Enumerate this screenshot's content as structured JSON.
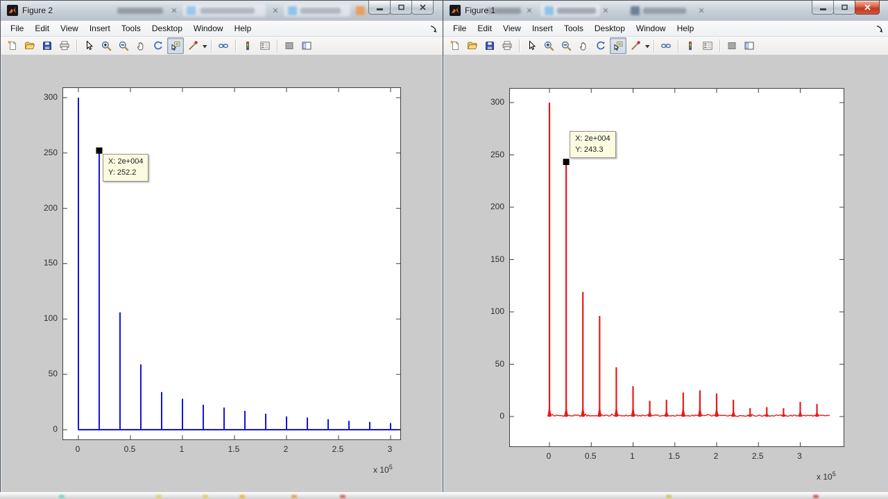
{
  "windows": [
    {
      "title": "Figure 2",
      "menu": [
        "File",
        "Edit",
        "View",
        "Insert",
        "Tools",
        "Desktop",
        "Window",
        "Help"
      ]
    },
    {
      "title": "Figure 1",
      "menu": [
        "File",
        "Edit",
        "View",
        "Insert",
        "Tools",
        "Desktop",
        "Window",
        "Help"
      ]
    }
  ],
  "toolbar": {
    "buttons": [
      {
        "name": "new-figure"
      },
      {
        "name": "open-file"
      },
      {
        "name": "save-figure"
      },
      {
        "name": "print-figure"
      },
      "separator",
      {
        "name": "edit-plot"
      },
      {
        "name": "zoom-in"
      },
      {
        "name": "zoom-out"
      },
      {
        "name": "pan"
      },
      {
        "name": "rotate-3d"
      },
      {
        "name": "data-cursor",
        "pressed": true
      },
      {
        "name": "brush",
        "caret": true
      },
      "separator",
      {
        "name": "link-plot"
      },
      "separator",
      {
        "name": "insert-colorbar"
      },
      {
        "name": "insert-legend"
      },
      "separator",
      {
        "name": "hide-plot-tools"
      },
      {
        "name": "show-plot-tools"
      }
    ]
  },
  "chart_data": [
    {
      "type": "stem",
      "window_title": "Figure 2",
      "series": [
        {
          "name": "spectrum-blue",
          "color": "#1212DF",
          "x": [
            0,
            20000,
            40000,
            60000,
            80000,
            100000,
            120000,
            140000,
            160000,
            180000,
            200000,
            220000,
            240000,
            260000,
            280000,
            300000
          ],
          "values": [
            300,
            252.2,
            106,
            59,
            34,
            28,
            22.5,
            20,
            17,
            14.5,
            12,
            11,
            9.5,
            8,
            7,
            6
          ]
        }
      ],
      "x_tick_labels": [
        "0",
        "0.5",
        "1",
        "1.5",
        "2",
        "2.5",
        "3"
      ],
      "x_tick_values_e5": [
        0,
        0.5,
        1,
        1.5,
        2,
        2.5,
        3
      ],
      "y_tick_labels": [
        "0",
        "50",
        "100",
        "150",
        "200",
        "250",
        "300"
      ],
      "y_tick_values": [
        0,
        50,
        100,
        150,
        200,
        250,
        300
      ],
      "x_scale": {
        "prefix": "x 10",
        "exponent": "5"
      },
      "xlim": [
        -15000,
        310000
      ],
      "ylim": [
        -9,
        309
      ],
      "grid": false,
      "baseline_noise": false,
      "datatip": {
        "x": 20000,
        "y": 252.2,
        "x_text": "X: 2e+004",
        "y_text": "Y: 252.2",
        "placement": "below-right"
      }
    },
    {
      "type": "stem",
      "window_title": "Figure 1",
      "series": [
        {
          "name": "spectrum-red",
          "color": "#E81A1A",
          "x": [
            0,
            20000,
            40000,
            60000,
            80000,
            100000,
            120000,
            140000,
            160000,
            180000,
            200000,
            220000,
            240000,
            260000,
            280000,
            300000,
            320000
          ],
          "values": [
            300,
            243.3,
            119,
            96,
            47,
            29,
            15,
            16,
            23,
            25,
            22,
            16,
            8,
            9,
            8,
            14,
            12
          ]
        }
      ],
      "x_tick_labels": [
        "0",
        "0.5",
        "1",
        "1.5",
        "2",
        "2.5",
        "3"
      ],
      "x_tick_values_e5": [
        0,
        0.5,
        1,
        1.5,
        2,
        2.5,
        3
      ],
      "y_tick_labels": [
        "0",
        "50",
        "100",
        "150",
        "200",
        "250",
        "300"
      ],
      "y_tick_values": [
        0,
        50,
        100,
        150,
        200,
        250,
        300
      ],
      "x_scale": {
        "prefix": "x 10",
        "exponent": "5"
      },
      "xlim": [
        -47000,
        353000
      ],
      "ylim": [
        -28,
        313
      ],
      "grid": false,
      "baseline_noise": true,
      "datatip": {
        "x": 20000,
        "y": 243.3,
        "x_text": "X: 2e+004",
        "y_text": "Y: 243.3",
        "placement": "above-right"
      }
    }
  ]
}
